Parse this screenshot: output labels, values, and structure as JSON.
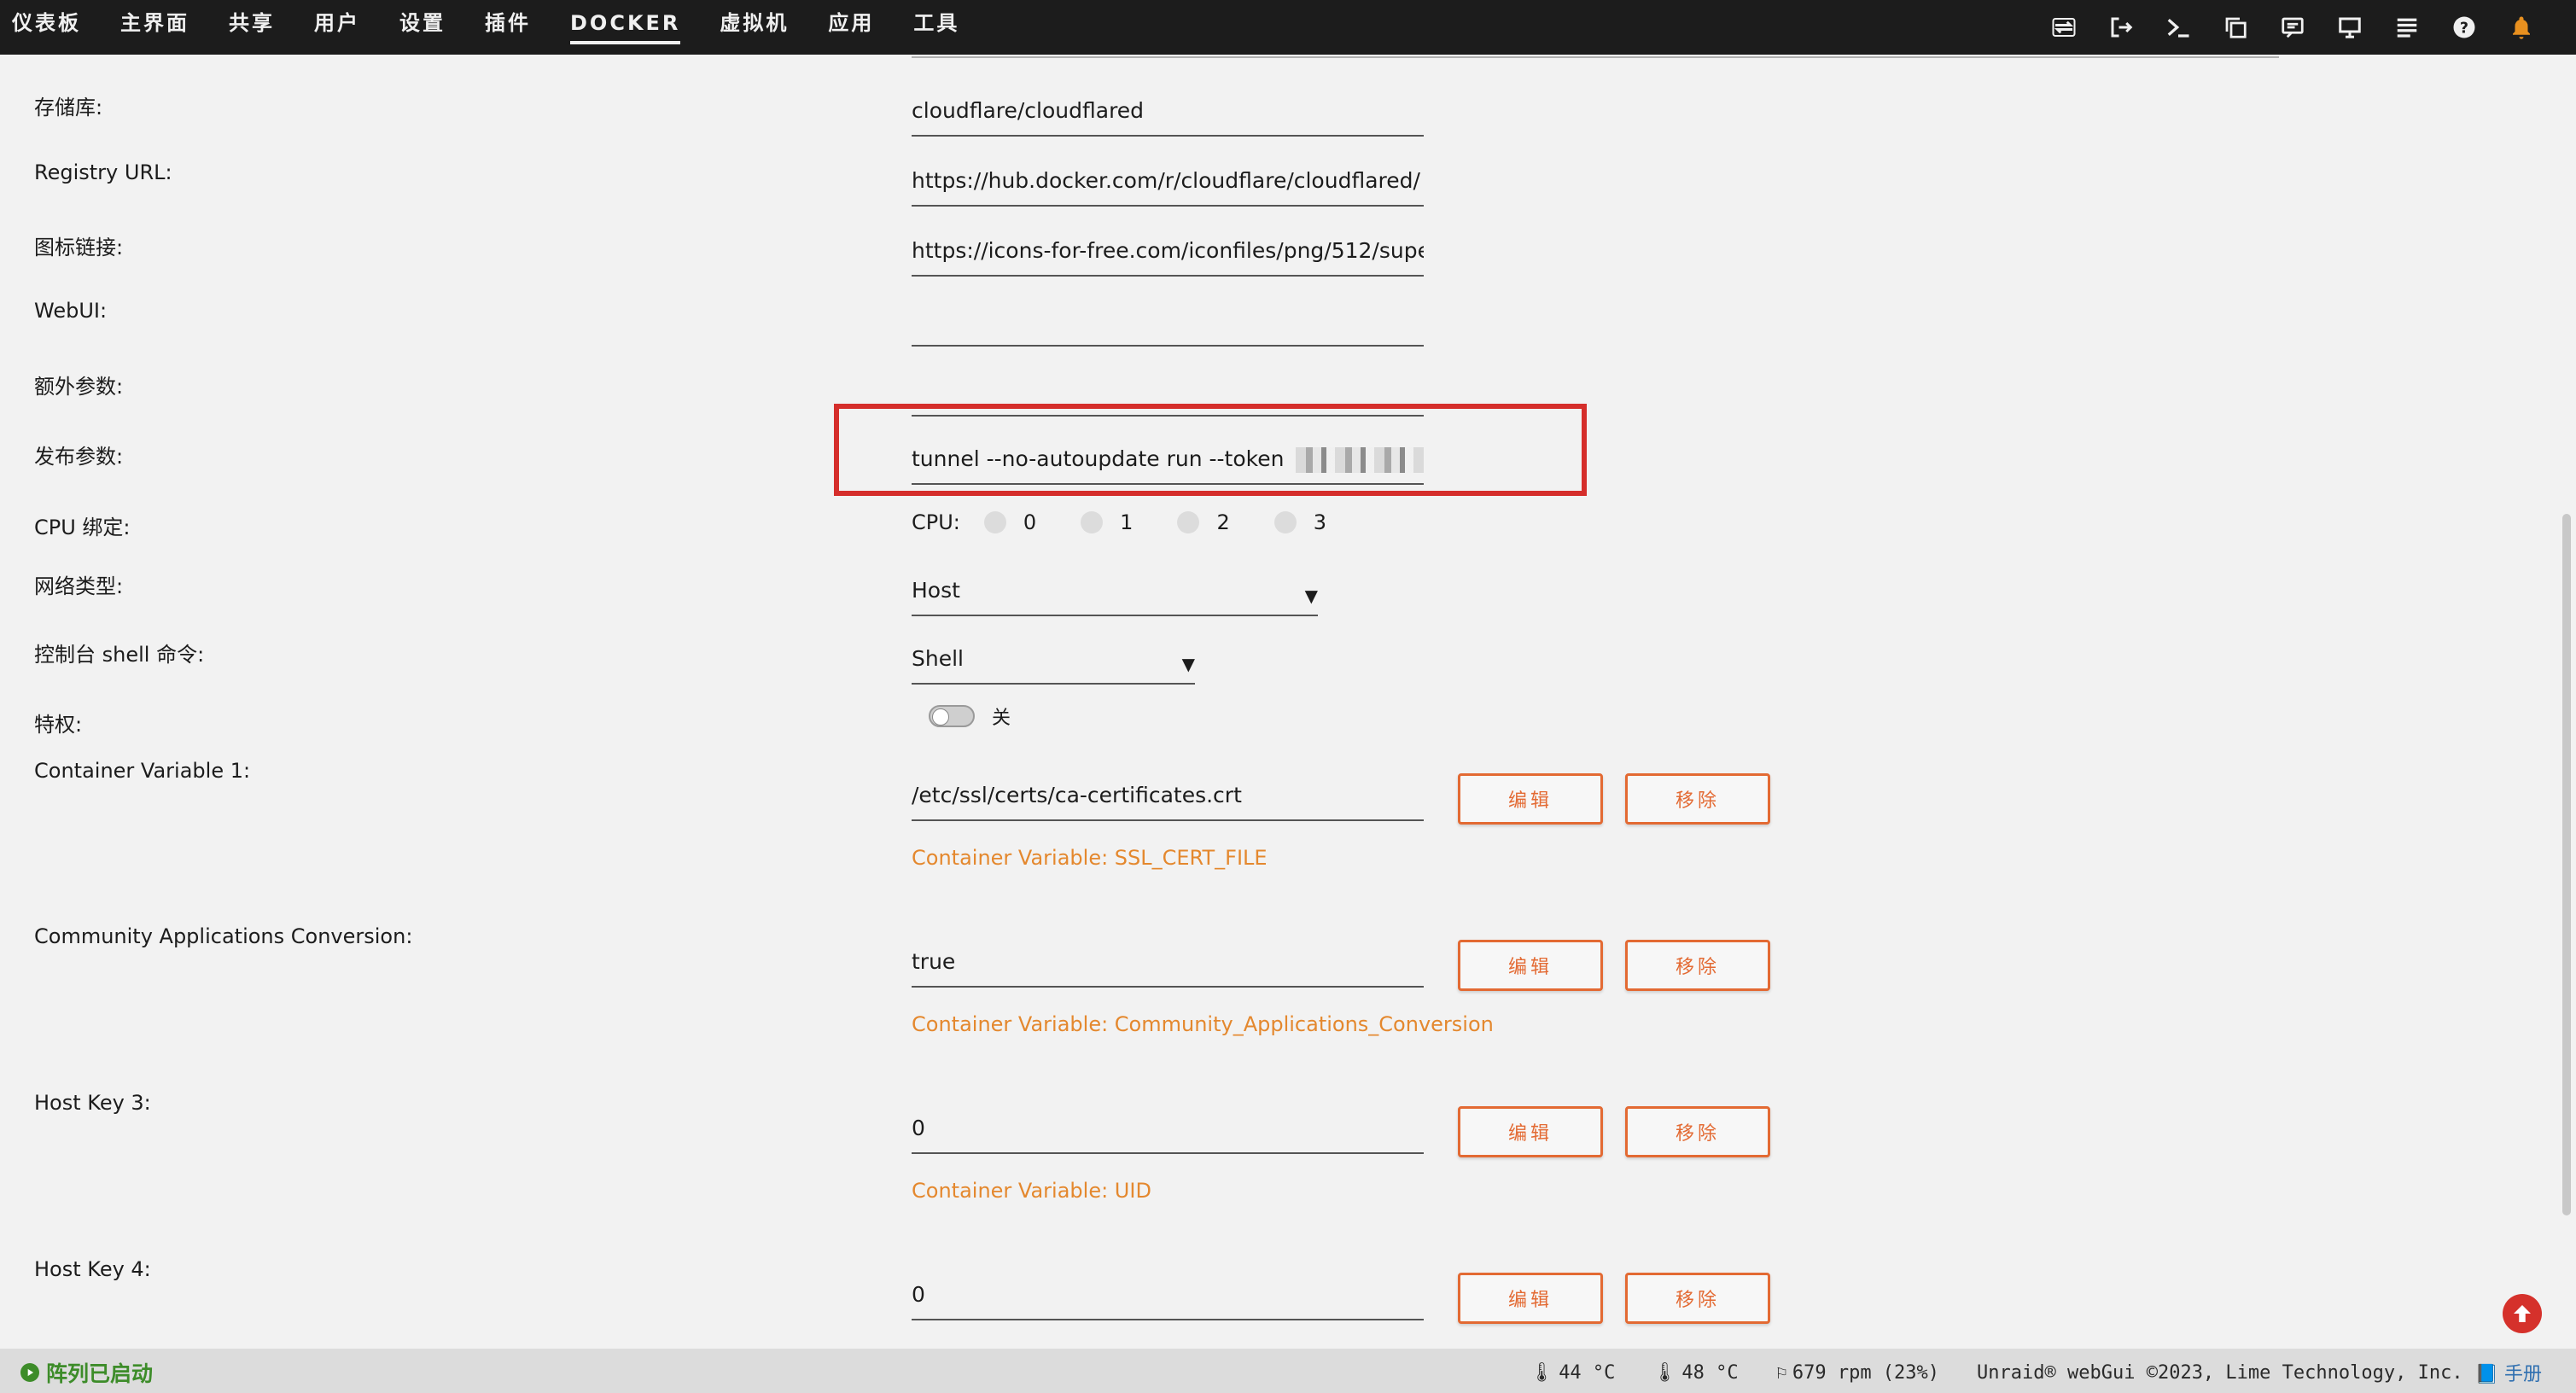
{
  "nav": {
    "items": [
      {
        "label": "仪表板"
      },
      {
        "label": "主界面"
      },
      {
        "label": "共享"
      },
      {
        "label": "用户"
      },
      {
        "label": "设置"
      },
      {
        "label": "插件"
      },
      {
        "label": "DOCKER",
        "active": true
      },
      {
        "label": "虚拟机"
      },
      {
        "label": "应用"
      },
      {
        "label": "工具"
      }
    ],
    "icons": [
      "transfer-icon",
      "logout-icon",
      "terminal-icon",
      "copy-window-icon",
      "feedback-icon",
      "display-icon",
      "log-icon",
      "help-icon",
      "bell-icon"
    ]
  },
  "form": {
    "repository": {
      "label": "存储库:",
      "value": "cloudflare/cloudflared"
    },
    "registry": {
      "label": "Registry URL:",
      "value": "https://hub.docker.com/r/cloudflare/cloudflared/"
    },
    "icon_url": {
      "label": "图标链接:",
      "value": "https://icons-for-free.com/iconfiles/png/512/supe"
    },
    "webui": {
      "label": "WebUI:",
      "value": ""
    },
    "extra_params": {
      "label": "额外参数:",
      "value": ""
    },
    "post_args": {
      "label": "发布参数:",
      "value": "tunnel --no-autoupdate run --token "
    },
    "cpu_pinning": {
      "label": "CPU 绑定:",
      "prefix": "CPU:",
      "options": [
        "0",
        "1",
        "2",
        "3"
      ]
    },
    "network_type": {
      "label": "网络类型:",
      "value": "Host"
    },
    "console_shell": {
      "label": "控制台 shell 命令:",
      "value": "Shell"
    },
    "privileged": {
      "label": "特权:",
      "state_label": "关",
      "on": false
    }
  },
  "variables": [
    {
      "label": "Container Variable 1:",
      "value": "/etc/ssl/certs/ca-certificates.crt",
      "desc": "Container Variable: SSL_CERT_FILE"
    },
    {
      "label": "Community Applications Conversion:",
      "value": "true",
      "desc": "Container Variable: Community_Applications_Conversion"
    },
    {
      "label": "Host Key 3:",
      "value": "0",
      "desc": "Container Variable: UID"
    },
    {
      "label": "Host Key 4:",
      "value": "0",
      "desc": ""
    }
  ],
  "buttons": {
    "edit": "编辑",
    "remove": "移除"
  },
  "footer": {
    "array_status": "阵列已启动",
    "temp1": "44 °C",
    "temp2": "48 °C",
    "fan": "679 rpm (23%)",
    "copyright": "Unraid® webGui ©2023, Lime Technology, Inc.",
    "manual": "手册"
  },
  "colors": {
    "accent": "#e36a33",
    "highlight": "#d52e2b",
    "status_green": "#3d8c29"
  }
}
